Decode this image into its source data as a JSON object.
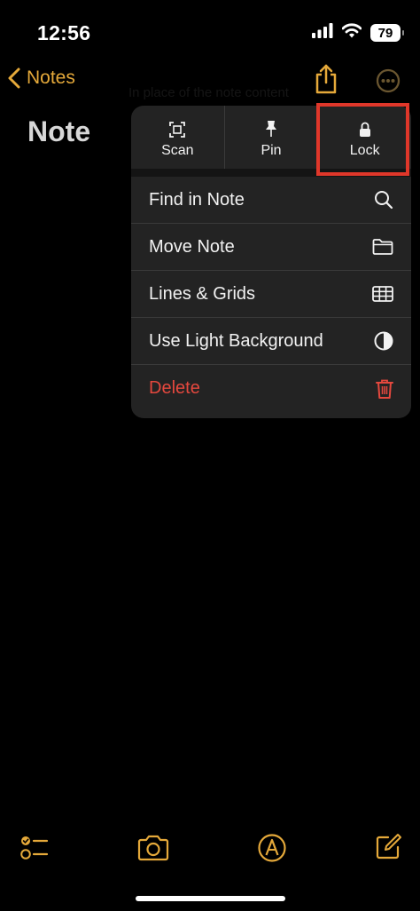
{
  "status": {
    "time": "12:56",
    "battery": "79"
  },
  "nav": {
    "back_label": "Notes",
    "background_text": "In place of the note content"
  },
  "note": {
    "title": "Note"
  },
  "menu": {
    "quick_actions": [
      {
        "label": "Scan",
        "icon": "scan-icon"
      },
      {
        "label": "Pin",
        "icon": "pin-icon"
      },
      {
        "label": "Lock",
        "icon": "lock-icon"
      }
    ],
    "items": [
      {
        "label": "Find in Note",
        "icon": "search-icon"
      },
      {
        "label": "Move Note",
        "icon": "folder-icon"
      },
      {
        "label": "Lines & Grids",
        "icon": "grid-icon"
      },
      {
        "label": "Use Light Background",
        "icon": "contrast-icon"
      },
      {
        "label": "Delete",
        "icon": "trash-icon"
      }
    ]
  },
  "toolbar": {
    "icons": [
      "checklist-icon",
      "camera-icon",
      "markup-icon",
      "compose-icon"
    ]
  },
  "colors": {
    "accent": "#e5a93a",
    "destructive": "#e5483e",
    "highlight": "#e0372a",
    "menu_bg": "#232323"
  }
}
